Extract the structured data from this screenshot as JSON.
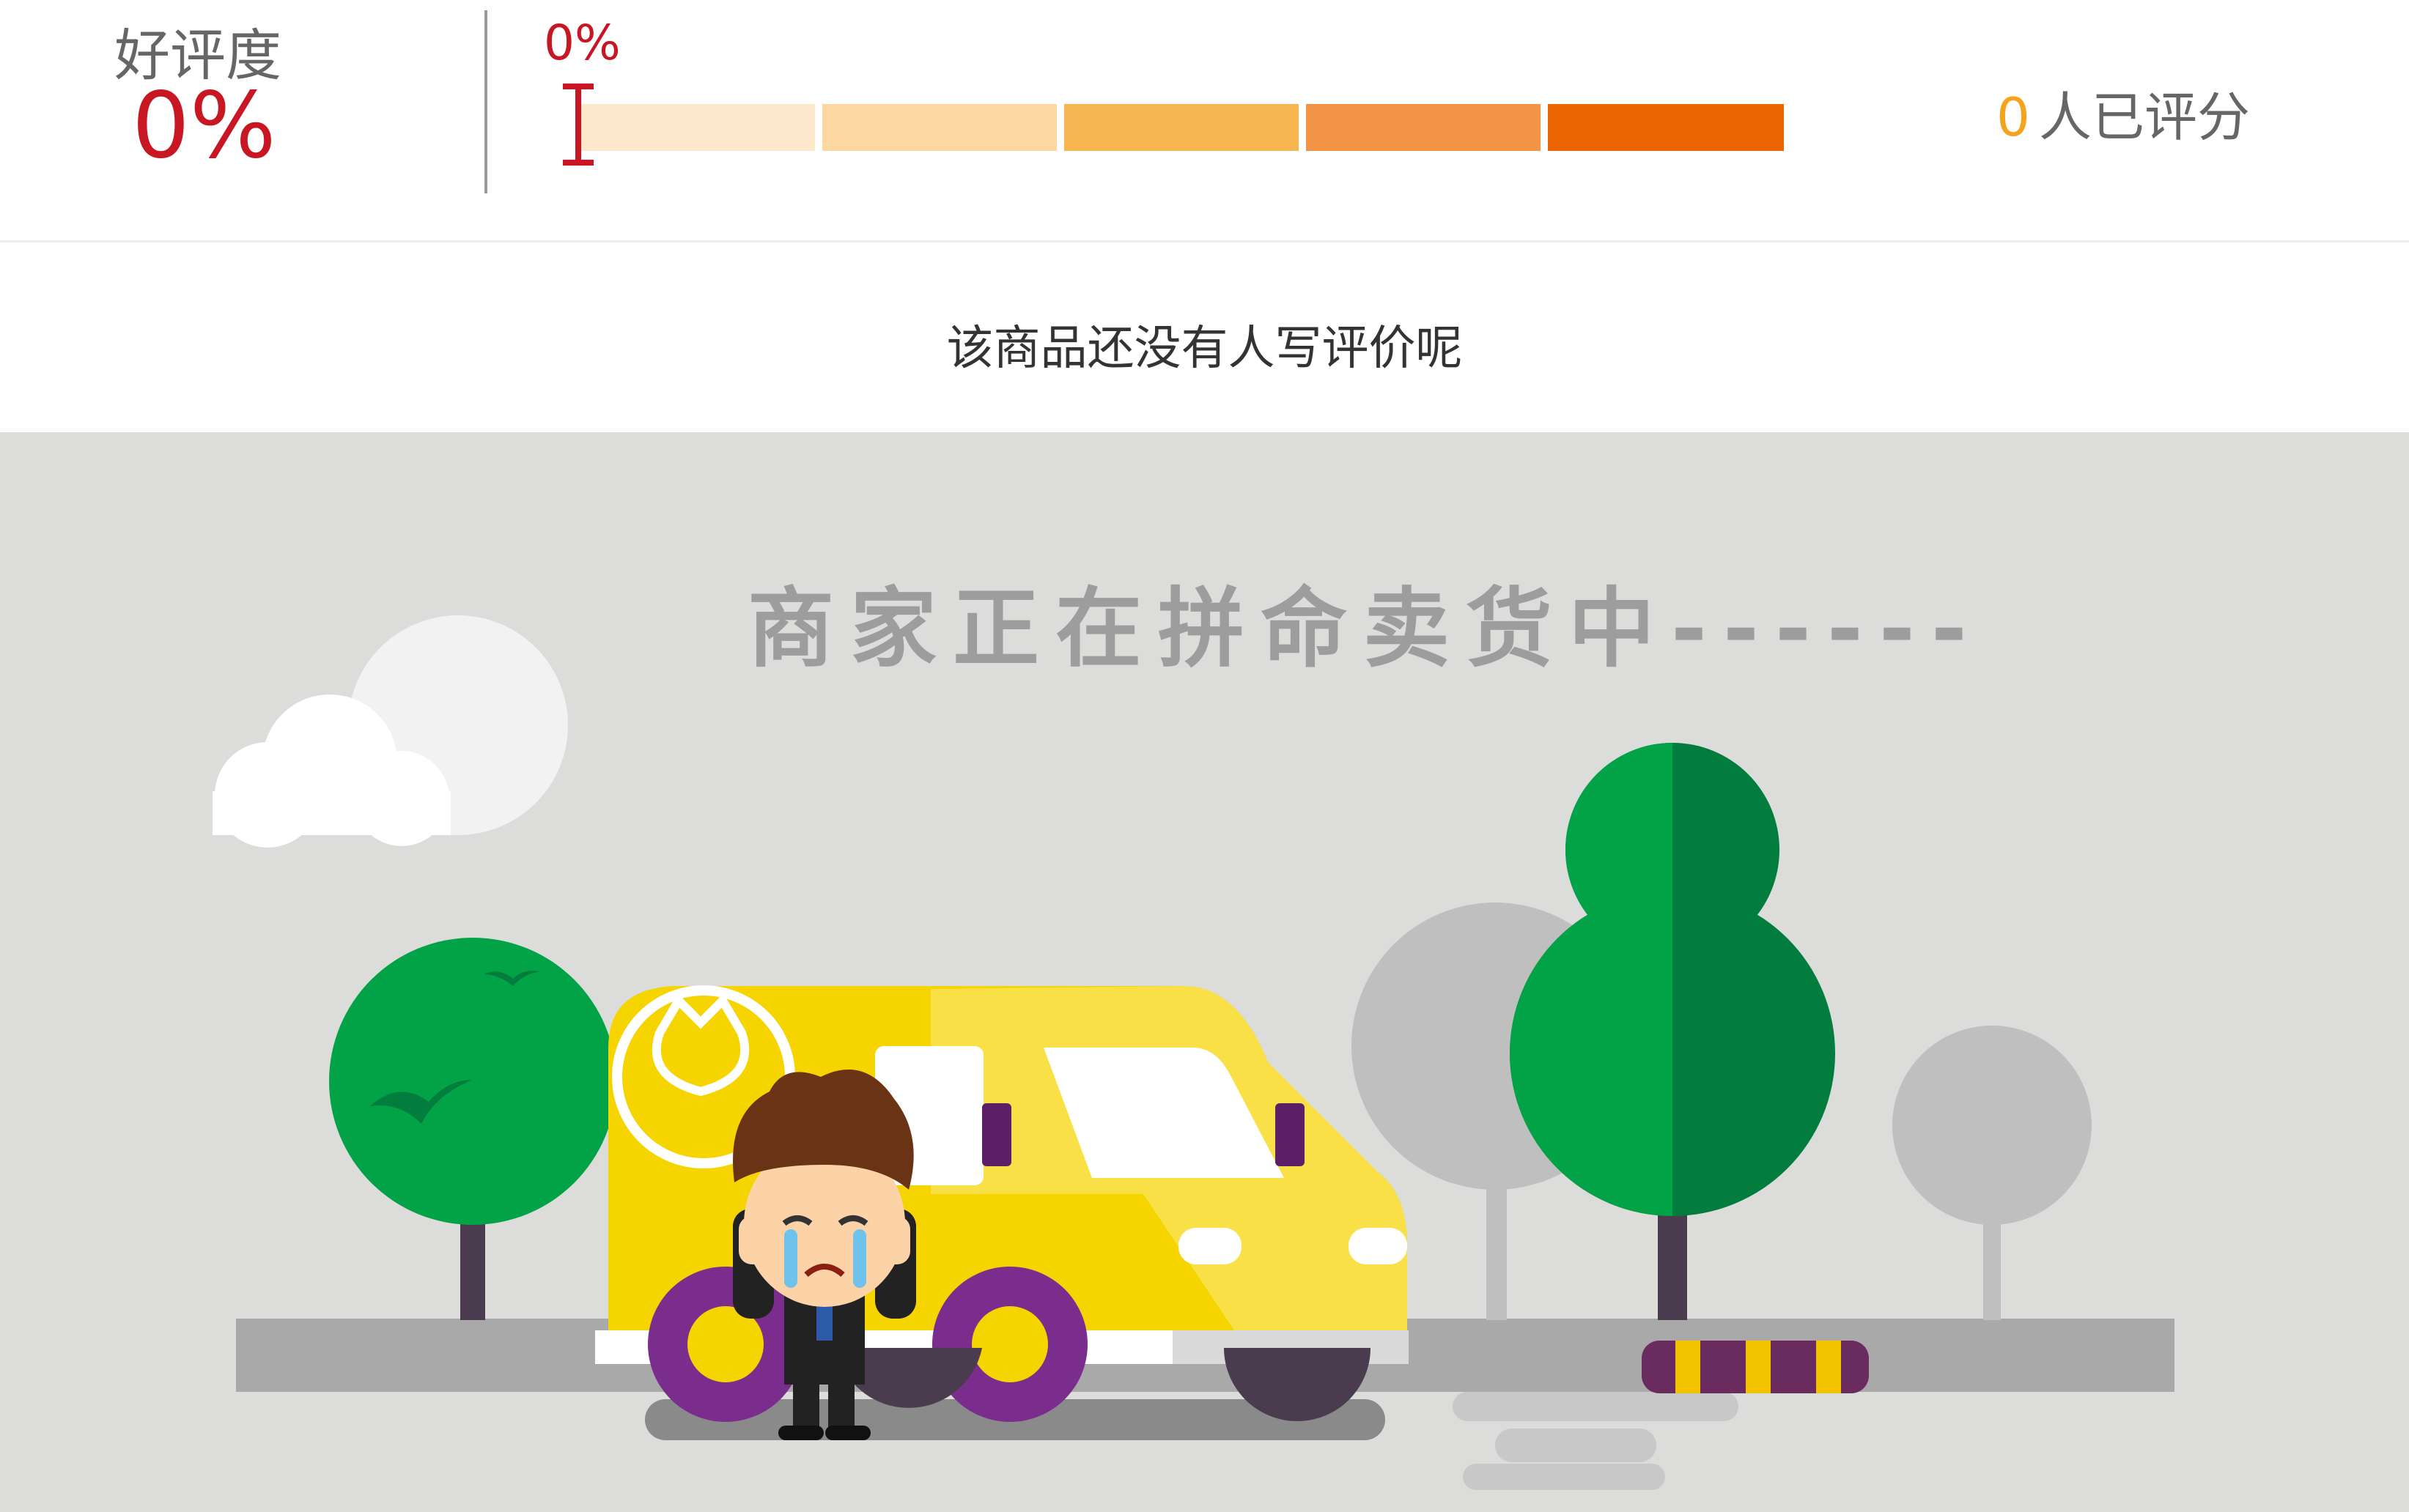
{
  "rating": {
    "label": "好评度",
    "value": "0%",
    "bar_percent_label": "0%",
    "bar_fill": 0,
    "segment_colors": [
      "#fde8cc",
      "#fdd8a1",
      "#f8b650",
      "#f29346",
      "#ec6504"
    ],
    "count": "0",
    "count_label": "人已评分"
  },
  "empty_message": "该商品还没有人写评价呢",
  "illustration": {
    "title": "商家正在拼命卖货中------",
    "icon": "crying-merchant-van-illustration"
  },
  "colors": {
    "accent_red": "#c81623",
    "count_orange": "#f3a31e",
    "scene_bg": "#dcdcdb"
  }
}
